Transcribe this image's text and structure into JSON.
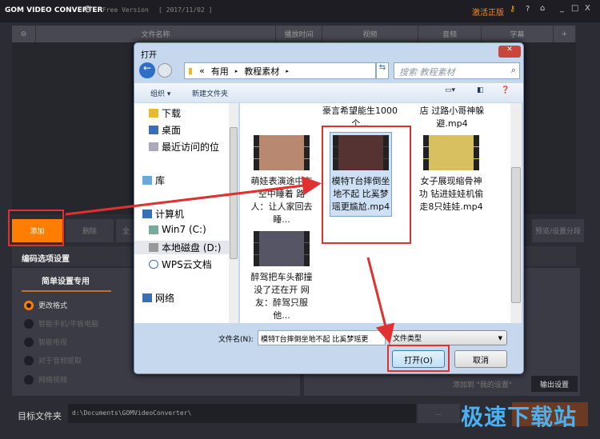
{
  "app": {
    "logo": "GOM VIDEO CONVERTER",
    "version": "Free Version",
    "date": "[ 2017/11/02 ]",
    "activate": "激活正版",
    "accent": "#ff7d00"
  },
  "table": {
    "columns": [
      "文件名称",
      "播放时间",
      "视频",
      "音频",
      "字幕",
      "+"
    ]
  },
  "actions": {
    "add": "添加",
    "delete": "删除",
    "all": "全",
    "preview": "预览/设置分段"
  },
  "encoding": {
    "title": "编码选项设置",
    "tab": "简单设置专用",
    "options": [
      "更改格式",
      "智能手机/平板电脑",
      "智能电视",
      "对于音频提取",
      "网络视频"
    ],
    "selected": 0,
    "add_to_mine": "添加到 \"我的设置\"",
    "output_settings": "输出设置"
  },
  "target": {
    "label": "目标文件夹",
    "path": "d:\\Documents\\GOMVideoConverter\\",
    "browse": "..."
  },
  "watermark": "极速下载站",
  "dialog": {
    "title": "打开",
    "path": [
      "«",
      "有用",
      "教程素材"
    ],
    "search_placeholder": "搜索 教程素材",
    "organize": "组织 ▾",
    "new_folder": "新建文件夹",
    "nav": [
      "下载",
      "桌面",
      "最近访问的位",
      "库",
      "计算机",
      "Win7 (C:)",
      "本地磁盘 (D:)",
      "WPS云文档",
      "网络"
    ],
    "files": [
      {
        "name": "豪言希望能生1000个..."
      },
      {
        "name": "店 过路小哥神躲避.mp4"
      },
      {
        "name": "萌娃表演途中在空中睡着 路人：让人家回去睡..."
      },
      {
        "name": "模特T台摔倒坐地不起 比奚梦瑶更尴尬.mp4",
        "selected": true
      },
      {
        "name": "女子展现缩骨神功 钻进娃娃机偷走8只娃娃.mp4"
      },
      {
        "name": "醉驾把车头都撞没了还在开 网友：醉驾只服他..."
      }
    ],
    "filename_label": "文件名(N):",
    "filename_value": "模特T台摔倒坐地不起 比奚梦瑶更",
    "filetype": "文件类型",
    "open": "打开(O)",
    "cancel": "取消"
  }
}
